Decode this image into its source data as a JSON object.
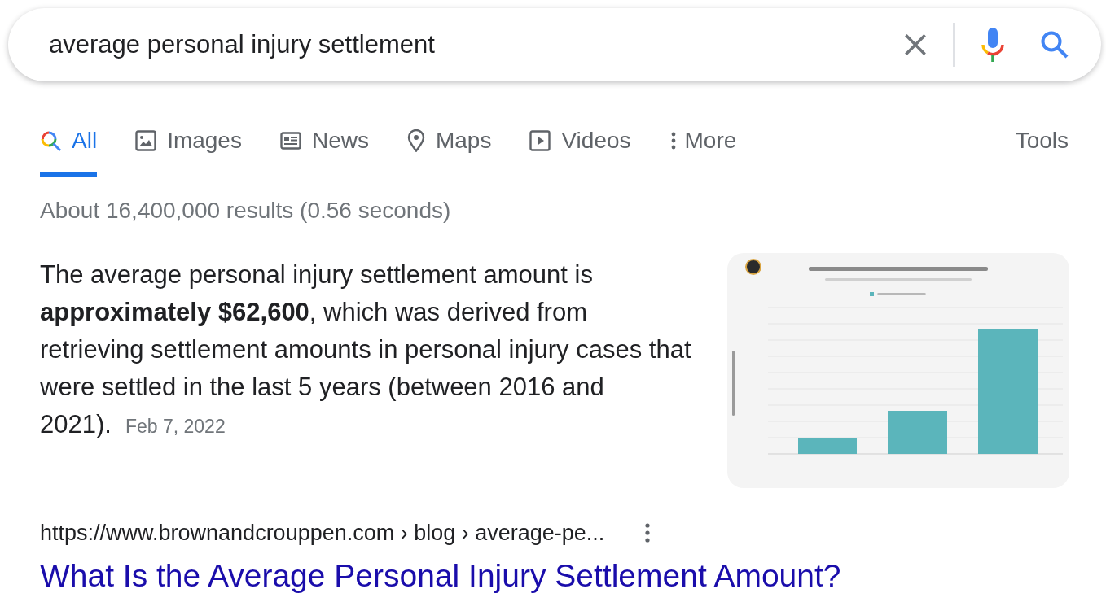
{
  "search": {
    "query": "average personal injury settlement"
  },
  "tabs": [
    {
      "label": "All",
      "selected": true
    },
    {
      "label": "Images",
      "selected": false
    },
    {
      "label": "News",
      "selected": false
    },
    {
      "label": "Maps",
      "selected": false
    },
    {
      "label": "Videos",
      "selected": false
    },
    {
      "label": "More",
      "selected": false
    }
  ],
  "tools": "Tools",
  "result_stats": "About 16,400,000 results (0.56 seconds)",
  "featured_snippet": {
    "text": "The average personal injury settlement amount is **approximately $62,600**, which was derived from retrieving settlement amounts in personal injury cases that were settled in the last 5 years (between 2016 and 2021).",
    "date": "Feb 7, 2022"
  },
  "result": {
    "url": "https://www.brownandcrouppen.com › blog › average-pe...",
    "title": "What Is the Average Personal Injury Settlement Amount?"
  }
}
